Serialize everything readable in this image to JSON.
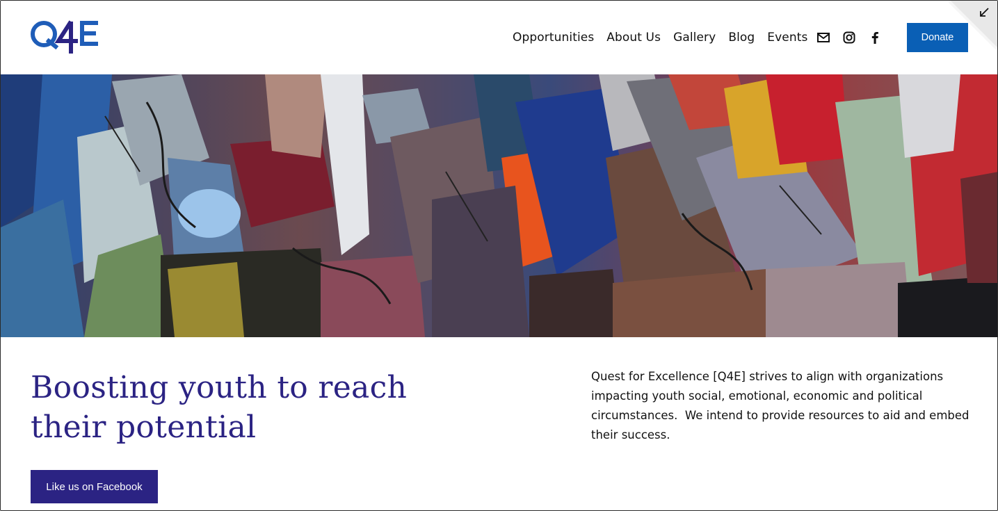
{
  "header": {
    "logo_text": "Q4E",
    "nav": [
      "Opportunities",
      "About Us",
      "Gallery",
      "Blog",
      "Events"
    ],
    "social_icons": [
      "mail-icon",
      "instagram-icon",
      "facebook-icon"
    ],
    "donate_label": "Donate"
  },
  "hero": {
    "headline": "Boosting youth to reach their potential",
    "cta_label": "Like us on Facebook",
    "description": "Quest for Excellence [Q4E] strives to align with organizations impacting youth social, emotional, economic and political circumstances.  We intend to provide resources to aid and embed their success."
  },
  "colors": {
    "brand_blue": "#0a5fb5",
    "headline_purple": "#2b2383"
  }
}
